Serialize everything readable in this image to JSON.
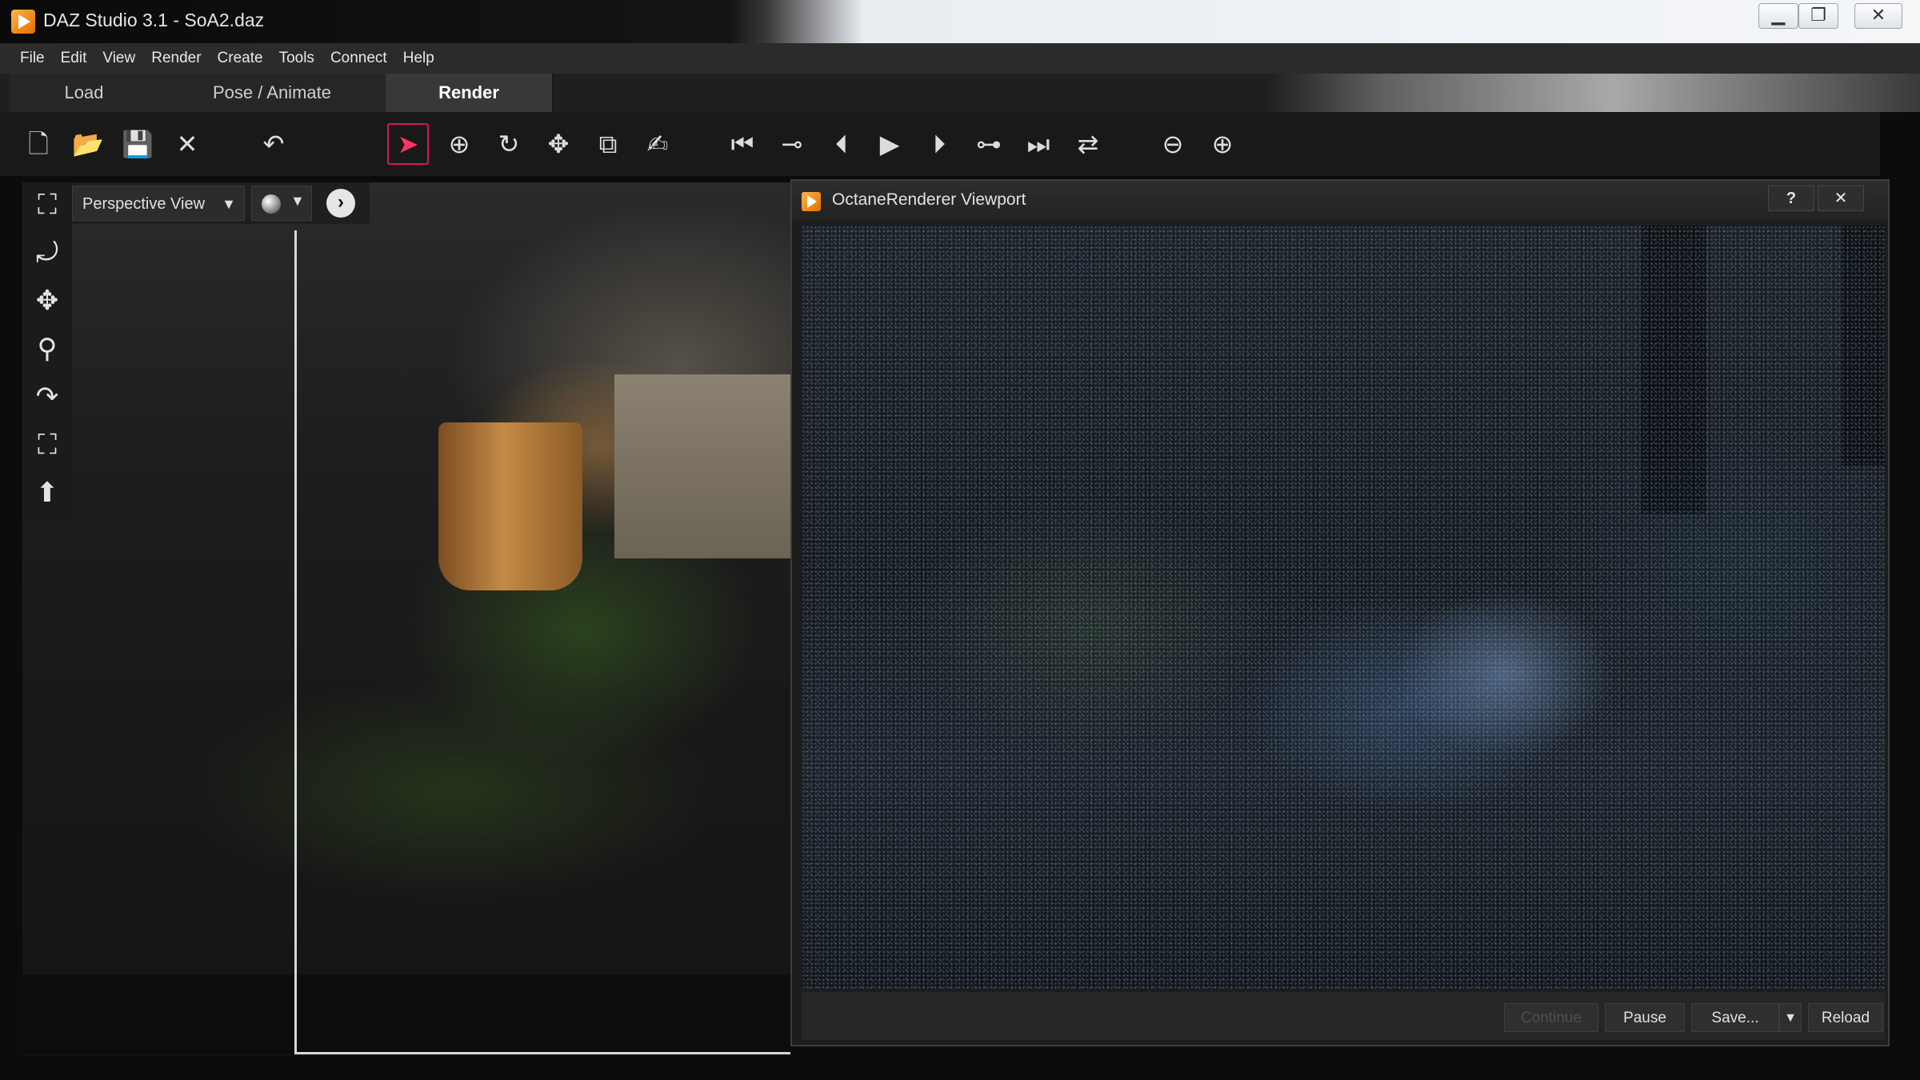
{
  "window": {
    "title": "DAZ Studio 3.1  - SoA2.daz"
  },
  "menu": [
    "File",
    "Edit",
    "View",
    "Render",
    "Create",
    "Tools",
    "Connect",
    "Help"
  ],
  "tabs": {
    "load": "Load",
    "pose": "Pose / Animate",
    "render": "Render",
    "active": "Render"
  },
  "toolbar": {
    "icons": [
      "new-file-icon",
      "open-folder-icon",
      "save-icon",
      "close-scene-icon",
      "undo-icon",
      "select-arrow-icon",
      "universal-tool-icon",
      "rotate-tool-icon",
      "translate-tool-icon",
      "scale-tool-icon",
      "joint-editor-icon",
      "go-to-start-icon",
      "previous-key-icon",
      "previous-frame-icon",
      "play-icon",
      "next-frame-icon",
      "next-key-icon",
      "go-to-end-icon",
      "loop-icon",
      "delete-key-icon",
      "add-key-icon"
    ],
    "active_tool": "select-arrow-icon"
  },
  "viewport": {
    "view_select": "Perspective View",
    "left_tools": [
      "camera-icon",
      "orbit-icon",
      "pan-icon",
      "zoom-icon",
      "rotate-view-icon",
      "frame-icon",
      "reset-view-icon"
    ]
  },
  "octane": {
    "title": "OctaneRenderer Viewport",
    "help_label": "?",
    "close_label": "✕",
    "buttons": {
      "continue": "Continue",
      "pause": "Pause",
      "save": "Save...",
      "reload": "Reload"
    }
  },
  "colors": {
    "accent": "#d6194f",
    "brand": "#f08a1c",
    "background": "#191919"
  }
}
